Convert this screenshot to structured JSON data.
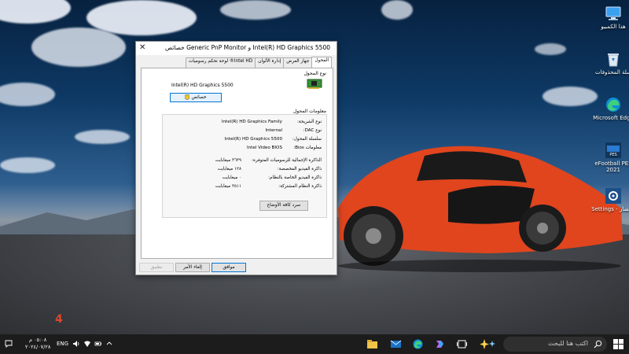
{
  "dialog": {
    "title": "خصائص Generic PnP Monitor و Intel(R) HD Graphics 5500",
    "tabs": [
      "المحول",
      "جهاز العرض",
      "إدارة الألوان",
      "لوحة تحكم رسوميات ®Intel HD"
    ],
    "adapter_type_label": "نوع المحول",
    "adapter_name": "Intel(R) HD Graphics 5500",
    "properties_button": "خصائص",
    "adapter_info_label": "معلومات المحول",
    "info_rows": [
      {
        "label": "نوع الشريحة:",
        "value": "Intel(R) HD Graphics Family"
      },
      {
        "label": "نوع DAC:",
        "value": "Internal"
      },
      {
        "label": "سلسلة المحول:",
        "value": "Intel(R) HD Graphics 5500"
      },
      {
        "label": "معلومات Bios:",
        "value": "Intel Video BIOS"
      }
    ],
    "memory_rows": [
      {
        "label": "الذاكرة الإجمالية للرسوميات المتوفرة:",
        "value": "٣٦٣٩ ميغابايت"
      },
      {
        "label": "ذاكرة الفيديو المخصصة:",
        "value": "١٢٨ ميغابايت"
      },
      {
        "label": "ذاكرة الفيديو الخاصة بالنظام:",
        "value": "٠ ميغابايت"
      },
      {
        "label": "ذاكرة النظام المشتركة:",
        "value": "٣٥١١ ميغابايت"
      }
    ],
    "list_modes_button": "سرد كافة الأوضاع",
    "ok_button": "موافق",
    "cancel_button": "إلغاء الأمر",
    "apply_button": "تطبيق"
  },
  "desktop_icons": [
    {
      "label": "هذا الكمبيو",
      "icon": "computer-icon"
    },
    {
      "label": "سلة المحذوفات",
      "icon": "recycle-bin-icon"
    },
    {
      "label": "Microsoft Edge",
      "icon": "edge-icon"
    },
    {
      "label": "eFootball PES 2021",
      "icon": "pes-icon"
    },
    {
      "label": "Settings - اختصار",
      "icon": "settings-shortcut-icon"
    }
  ],
  "taskbar": {
    "search_placeholder": "اكتب هنا للبحث",
    "language": "ENG",
    "clock_time": "٠٥:٠٨ م",
    "clock_date": "٢٠٢٤/٠٧/٢٨",
    "watermark": "4"
  },
  "colors": {
    "accent": "#0078d7",
    "taskbar": "#1c1c1c",
    "car": "#e0451e"
  }
}
